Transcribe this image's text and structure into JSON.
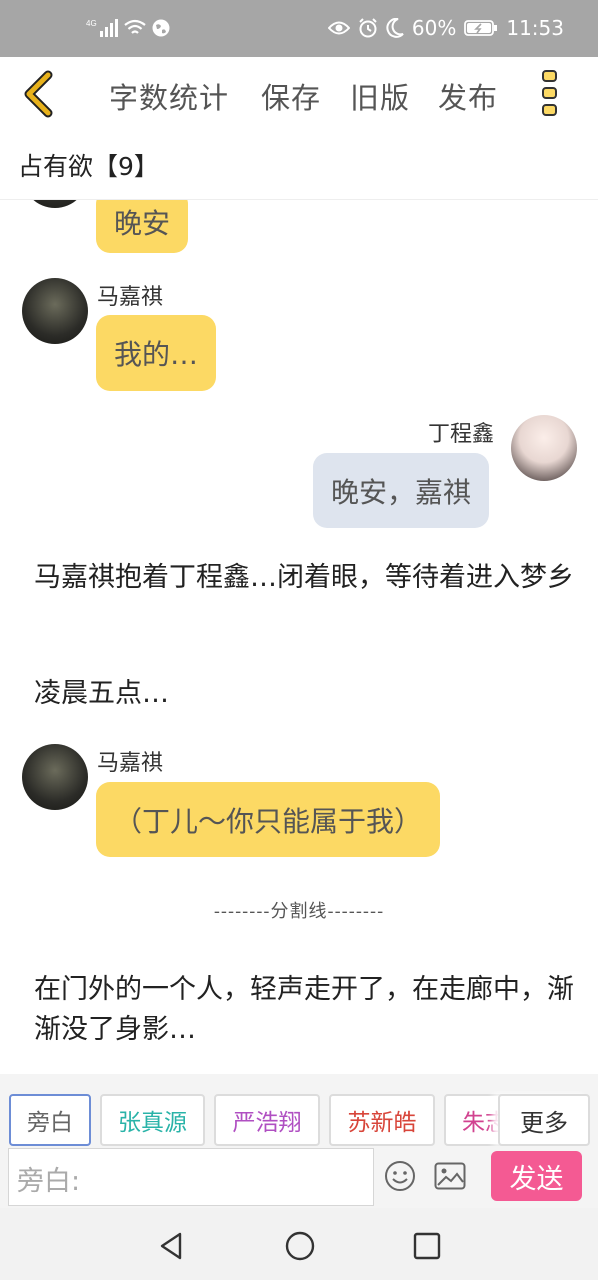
{
  "status_bar": {
    "network": "4G",
    "battery": "60%",
    "time": "11:53"
  },
  "toolbar": {
    "word_count": "字数统计",
    "save": "保存",
    "old_version": "旧版",
    "publish": "发布"
  },
  "doc_title": "占有欲【9】",
  "messages": [
    {
      "type": "chat",
      "side": "left",
      "speaker": "",
      "text": "晚安"
    },
    {
      "type": "chat",
      "side": "left",
      "speaker": "马嘉祺",
      "text": "我的…"
    },
    {
      "type": "chat",
      "side": "right",
      "speaker": "丁程鑫",
      "text": "晚安，嘉祺"
    },
    {
      "type": "narration",
      "text": "马嘉祺抱着丁程鑫…闭着眼，等待着进入梦乡"
    },
    {
      "type": "narration",
      "text": "凌晨五点…"
    },
    {
      "type": "chat",
      "side": "left",
      "speaker": "马嘉祺",
      "text": "（丁儿～你只能属于我）"
    },
    {
      "type": "divider",
      "text": "--------分割线--------"
    },
    {
      "type": "narration",
      "text": "在门外的一个人，轻声走开了，在走廊中，渐渐没了身影…"
    }
  ],
  "characters": [
    {
      "label": "旁白",
      "color": "#666666"
    },
    {
      "label": "张真源",
      "color": "#29b3a8"
    },
    {
      "label": "严浩翔",
      "color": "#b04fc2"
    },
    {
      "label": "苏新皓",
      "color": "#d8453a"
    },
    {
      "label": "朱志",
      "color": "#d1428f"
    }
  ],
  "more_label": "更多",
  "input": {
    "placeholder": "旁白:"
  },
  "send_label": "发送",
  "colors": {
    "status_bar_bg": "#a6a6a6",
    "accent_yellow": "#fcd964",
    "bubble_grey": "#dee4ee",
    "send_pink": "#f45a93",
    "back_arrow": "#e8b21c"
  }
}
